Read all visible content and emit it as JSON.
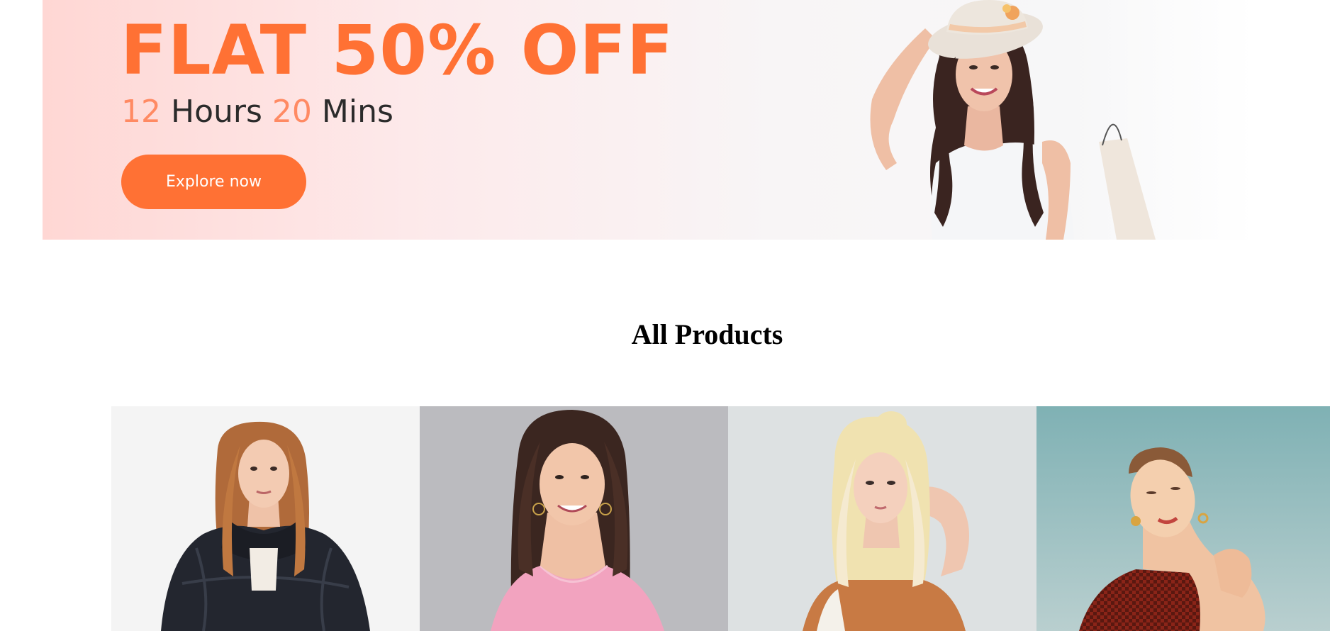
{
  "hero": {
    "headline": "FLAT 50% OFF",
    "timer": {
      "hours_value": "12",
      "hours_label": "Hours",
      "minutes_value": "20",
      "minutes_label": "Mins"
    },
    "cta_label": "Explore now",
    "colors": {
      "accent": "#ff7134",
      "timer_number": "#ff8a63",
      "text": "#2b2b2b"
    }
  },
  "products_section": {
    "title": "All Products",
    "items": [
      {
        "image_alt": "Woman with long auburn hair wearing a dark navy faux fur coat"
      },
      {
        "image_alt": "Smiling woman with long brown hair wearing a pink top"
      },
      {
        "image_alt": "Blonde woman with hand in hair wearing an orange top"
      },
      {
        "image_alt": "Red-haired woman in sunlight wearing a patterned red top"
      }
    ]
  }
}
